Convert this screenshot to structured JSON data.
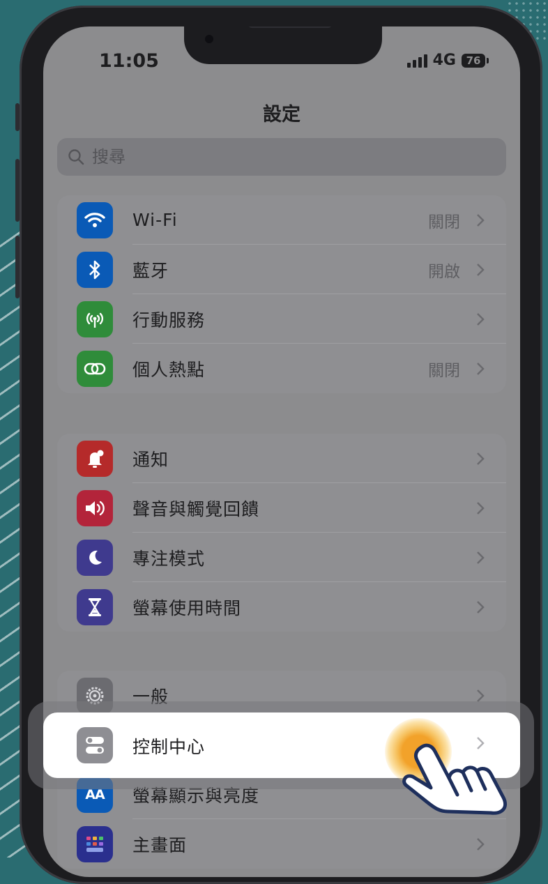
{
  "status_bar": {
    "time": "11:05",
    "network": "4G",
    "battery": "76"
  },
  "header": {
    "title": "設定"
  },
  "search": {
    "placeholder": "搜尋"
  },
  "groups": [
    {
      "items": [
        {
          "label": "Wi-Fi",
          "value": "關閉",
          "icon": "wifi-icon",
          "color": "#0a5ab6"
        },
        {
          "label": "藍牙",
          "value": "開啟",
          "icon": "bluetooth-icon",
          "color": "#0a5ab6"
        },
        {
          "label": "行動服務",
          "value": "",
          "icon": "antenna-icon",
          "color": "#2f8c3a"
        },
        {
          "label": "個人熱點",
          "value": "關閉",
          "icon": "hotspot-icon",
          "color": "#2f8c3a"
        }
      ]
    },
    {
      "items": [
        {
          "label": "通知",
          "value": "",
          "icon": "notification-bell-icon",
          "color": "#b52a2a"
        },
        {
          "label": "聲音與觸覺回饋",
          "value": "",
          "icon": "speaker-icon",
          "color": "#b3243a"
        },
        {
          "label": "專注模式",
          "value": "",
          "icon": "moon-icon",
          "color": "#3f3a8e"
        },
        {
          "label": "螢幕使用時間",
          "value": "",
          "icon": "hourglass-icon",
          "color": "#3f3a8e"
        }
      ]
    },
    {
      "items": [
        {
          "label": "一般",
          "value": "",
          "icon": "gear-icon",
          "color": "#6b6b70"
        },
        {
          "label": "控制中心",
          "value": "",
          "icon": "toggles-icon",
          "color": "#8e8e93",
          "highlighted": true
        },
        {
          "label": "螢幕顯示與亮度",
          "value": "",
          "icon": "text-size-icon",
          "color": "#0a5ab6"
        },
        {
          "label": "主畫面",
          "value": "",
          "icon": "home-grid-icon",
          "color": "#2a2f8e"
        }
      ]
    }
  ]
}
